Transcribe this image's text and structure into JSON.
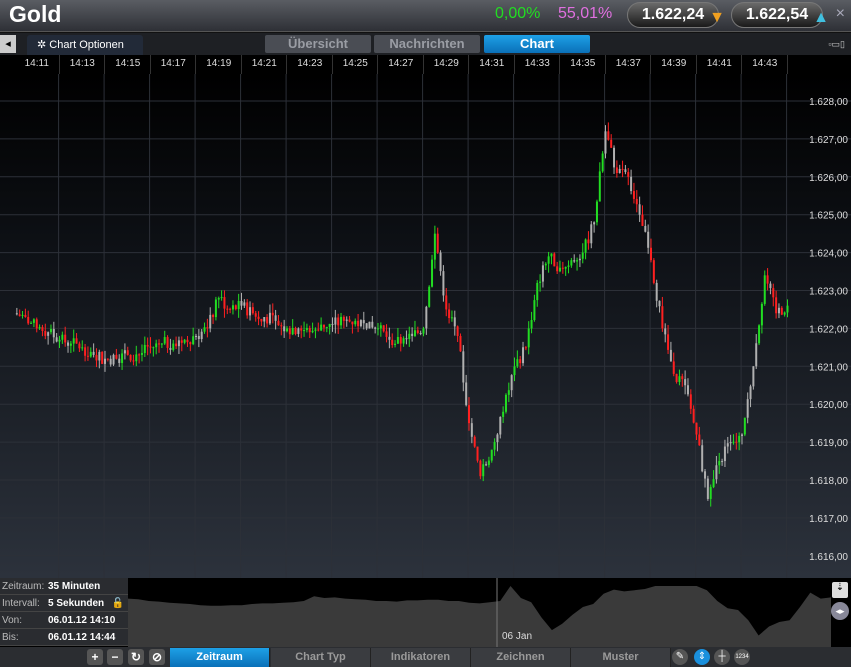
{
  "header": {
    "title": "Gold",
    "change": "0,00%",
    "percent": "55,01%",
    "bid": "1.622,24",
    "ask": "1.622,54",
    "close": "×"
  },
  "toolbar": {
    "chart_options": "Chart Optionen",
    "tabs": [
      "Übersicht",
      "Nachrichten",
      "Chart"
    ],
    "active_tab": "Chart"
  },
  "info": {
    "zeitraum_label": "Zeitraum:",
    "zeitraum": "35 Minuten",
    "intervall_label": "Intervall:",
    "intervall": "5 Sekunden",
    "von_label": "Von:",
    "von": "06.01.12 14:10",
    "bis_label": "Bis:",
    "bis": "06.01.12 14:44"
  },
  "overview": {
    "date_label": "06 Jan"
  },
  "bottom_tabs": [
    "Zeitraum",
    "Chart Typ",
    "Indikatoren",
    "Zeichnen",
    "Muster"
  ],
  "colors": {
    "up": "#22dd22",
    "down": "#ff2020",
    "neutral": "#b0b0b0",
    "accent": "#1a90dd"
  },
  "chart_data": {
    "type": "candlestick",
    "x_start": "14:10",
    "x_step_minutes": 0.5,
    "xticks": [
      "14:11",
      "14:13",
      "14:15",
      "14:17",
      "14:19",
      "14:21",
      "14:23",
      "14:25",
      "14:27",
      "14:29",
      "14:31",
      "14:33",
      "14:35",
      "14:37",
      "14:39",
      "14:41",
      "14:43"
    ],
    "yticks": [
      "1.628,00",
      "1.627,00",
      "1.626,00",
      "1.625,00",
      "1.624,00",
      "1.623,00",
      "1.622,00",
      "1.621,00",
      "1.620,00",
      "1.619,00",
      "1.618,00",
      "1.617,00",
      "1.616,00"
    ],
    "ylim": [
      1615.4,
      1628.7
    ],
    "closes": [
      1622.4,
      1622.3,
      1622.0,
      1621.9,
      1621.7,
      1621.6,
      1621.5,
      1621.3,
      1621.2,
      1621.2,
      1621.3,
      1621.3,
      1621.5,
      1621.6,
      1621.6,
      1621.7,
      1621.8,
      1622.0,
      1622.8,
      1622.5,
      1622.6,
      1622.4,
      1622.3,
      1622.2,
      1622.0,
      1622.0,
      1621.9,
      1622.1,
      1622.1,
      1622.2,
      1622.2,
      1622.0,
      1622.0,
      1621.7,
      1621.6,
      1621.8,
      1622.0,
      1624.5,
      1622.5,
      1621.8,
      1619.5,
      1618.1,
      1618.8,
      1619.8,
      1621.0,
      1621.5,
      1623.2,
      1623.9,
      1623.6,
      1623.8,
      1624.0,
      1624.8,
      1627.2,
      1626.1,
      1626.0,
      1625.0,
      1623.8,
      1622.0,
      1620.8,
      1620.5,
      1619.2,
      1617.5,
      1618.5,
      1619.0,
      1619.2,
      1621.0,
      1623.4,
      1622.4,
      1622.6
    ]
  }
}
